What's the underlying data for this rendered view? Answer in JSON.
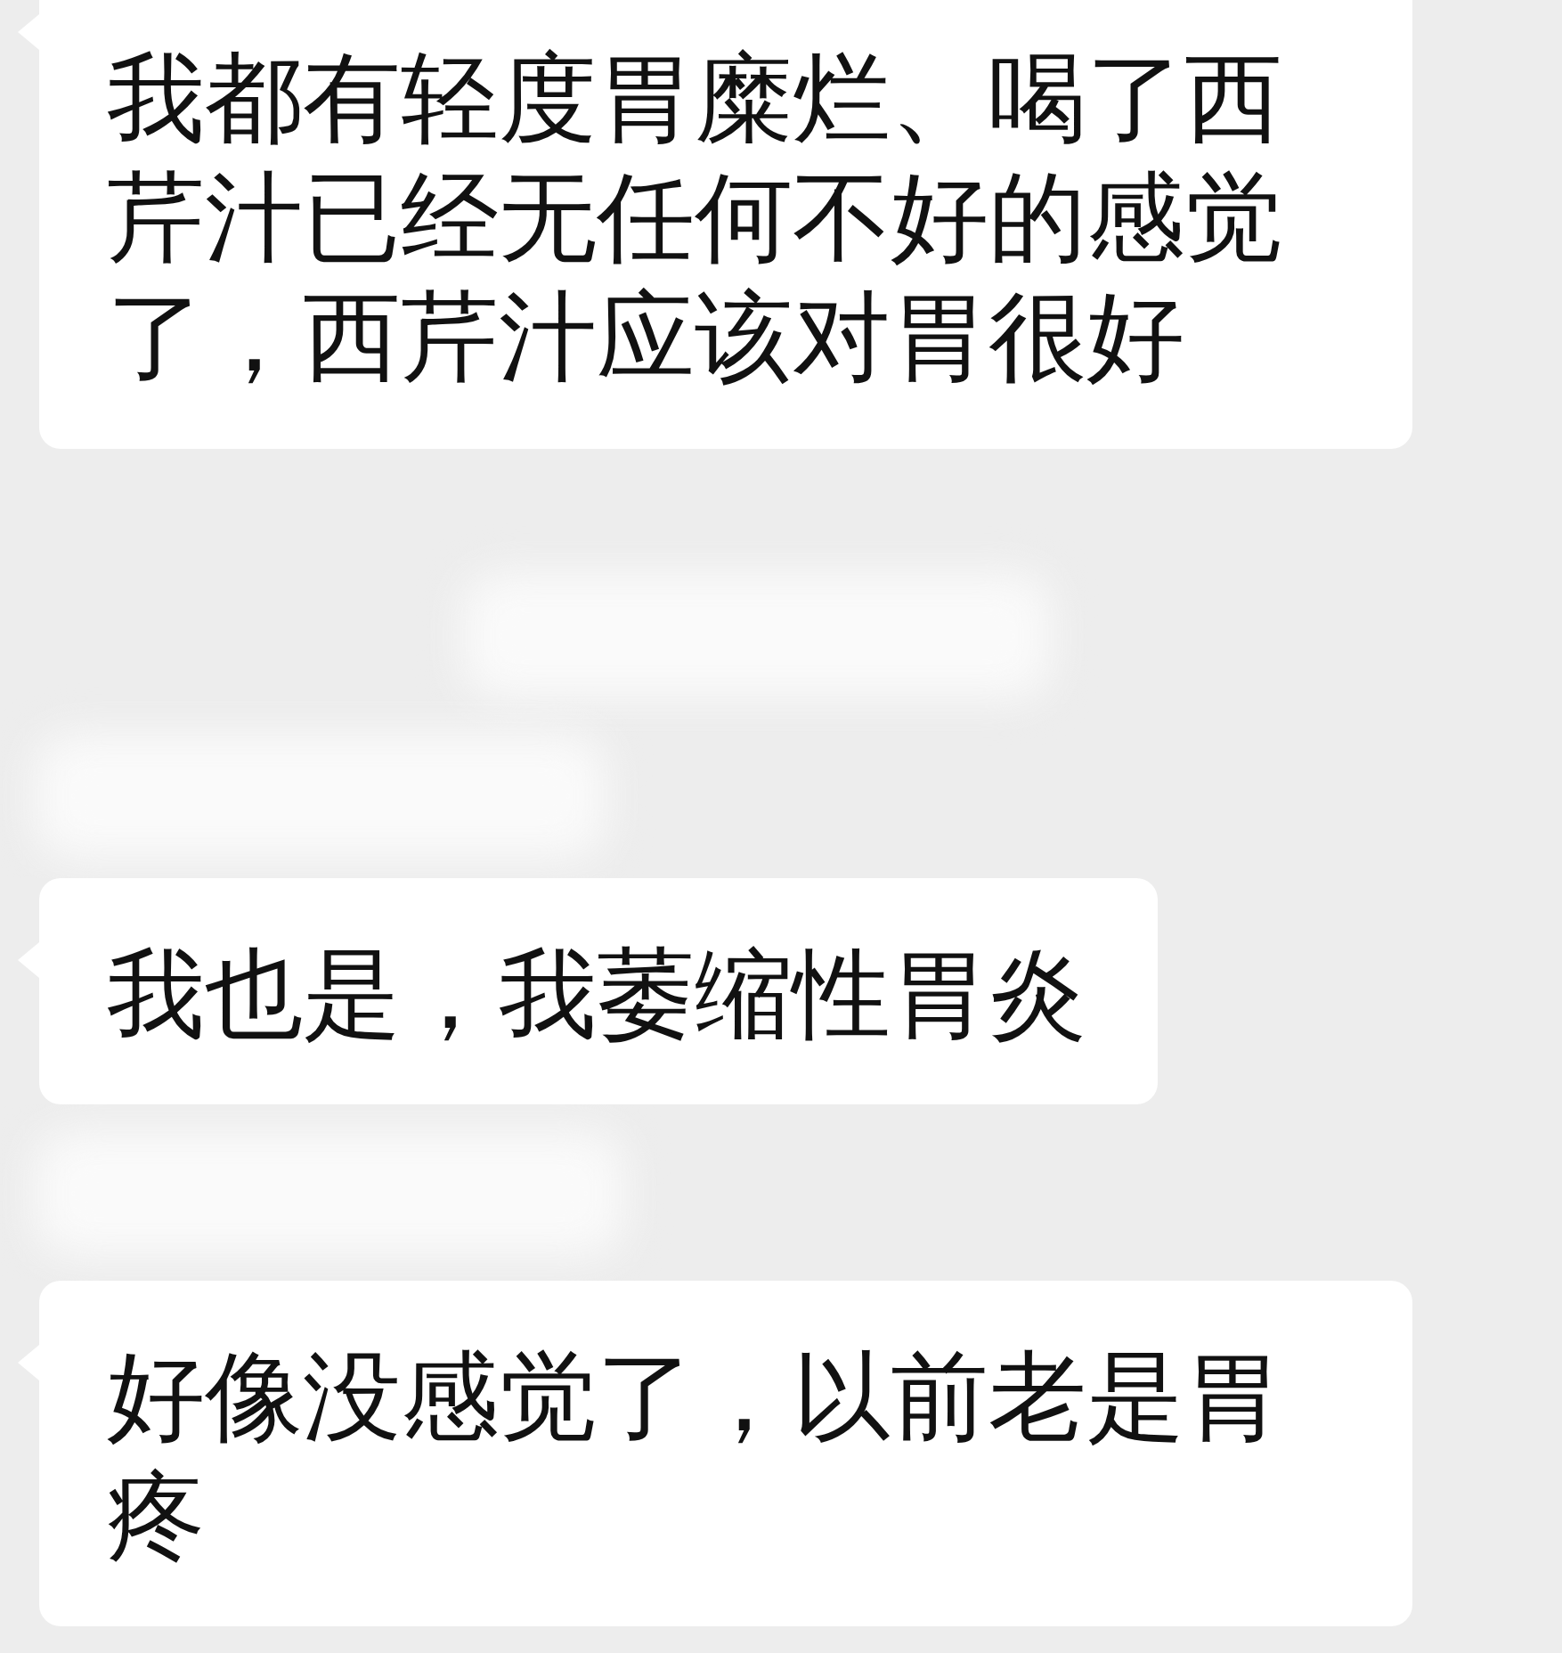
{
  "messages": [
    {
      "text": "我都有轻度胃糜烂、喝了西芹汁已经无任何不好的感觉了，西芹汁应该对胃很好"
    },
    {
      "text": "我也是，我萎缩性胃炎"
    },
    {
      "text": "好像没感觉了，以前老是胃疼"
    }
  ]
}
